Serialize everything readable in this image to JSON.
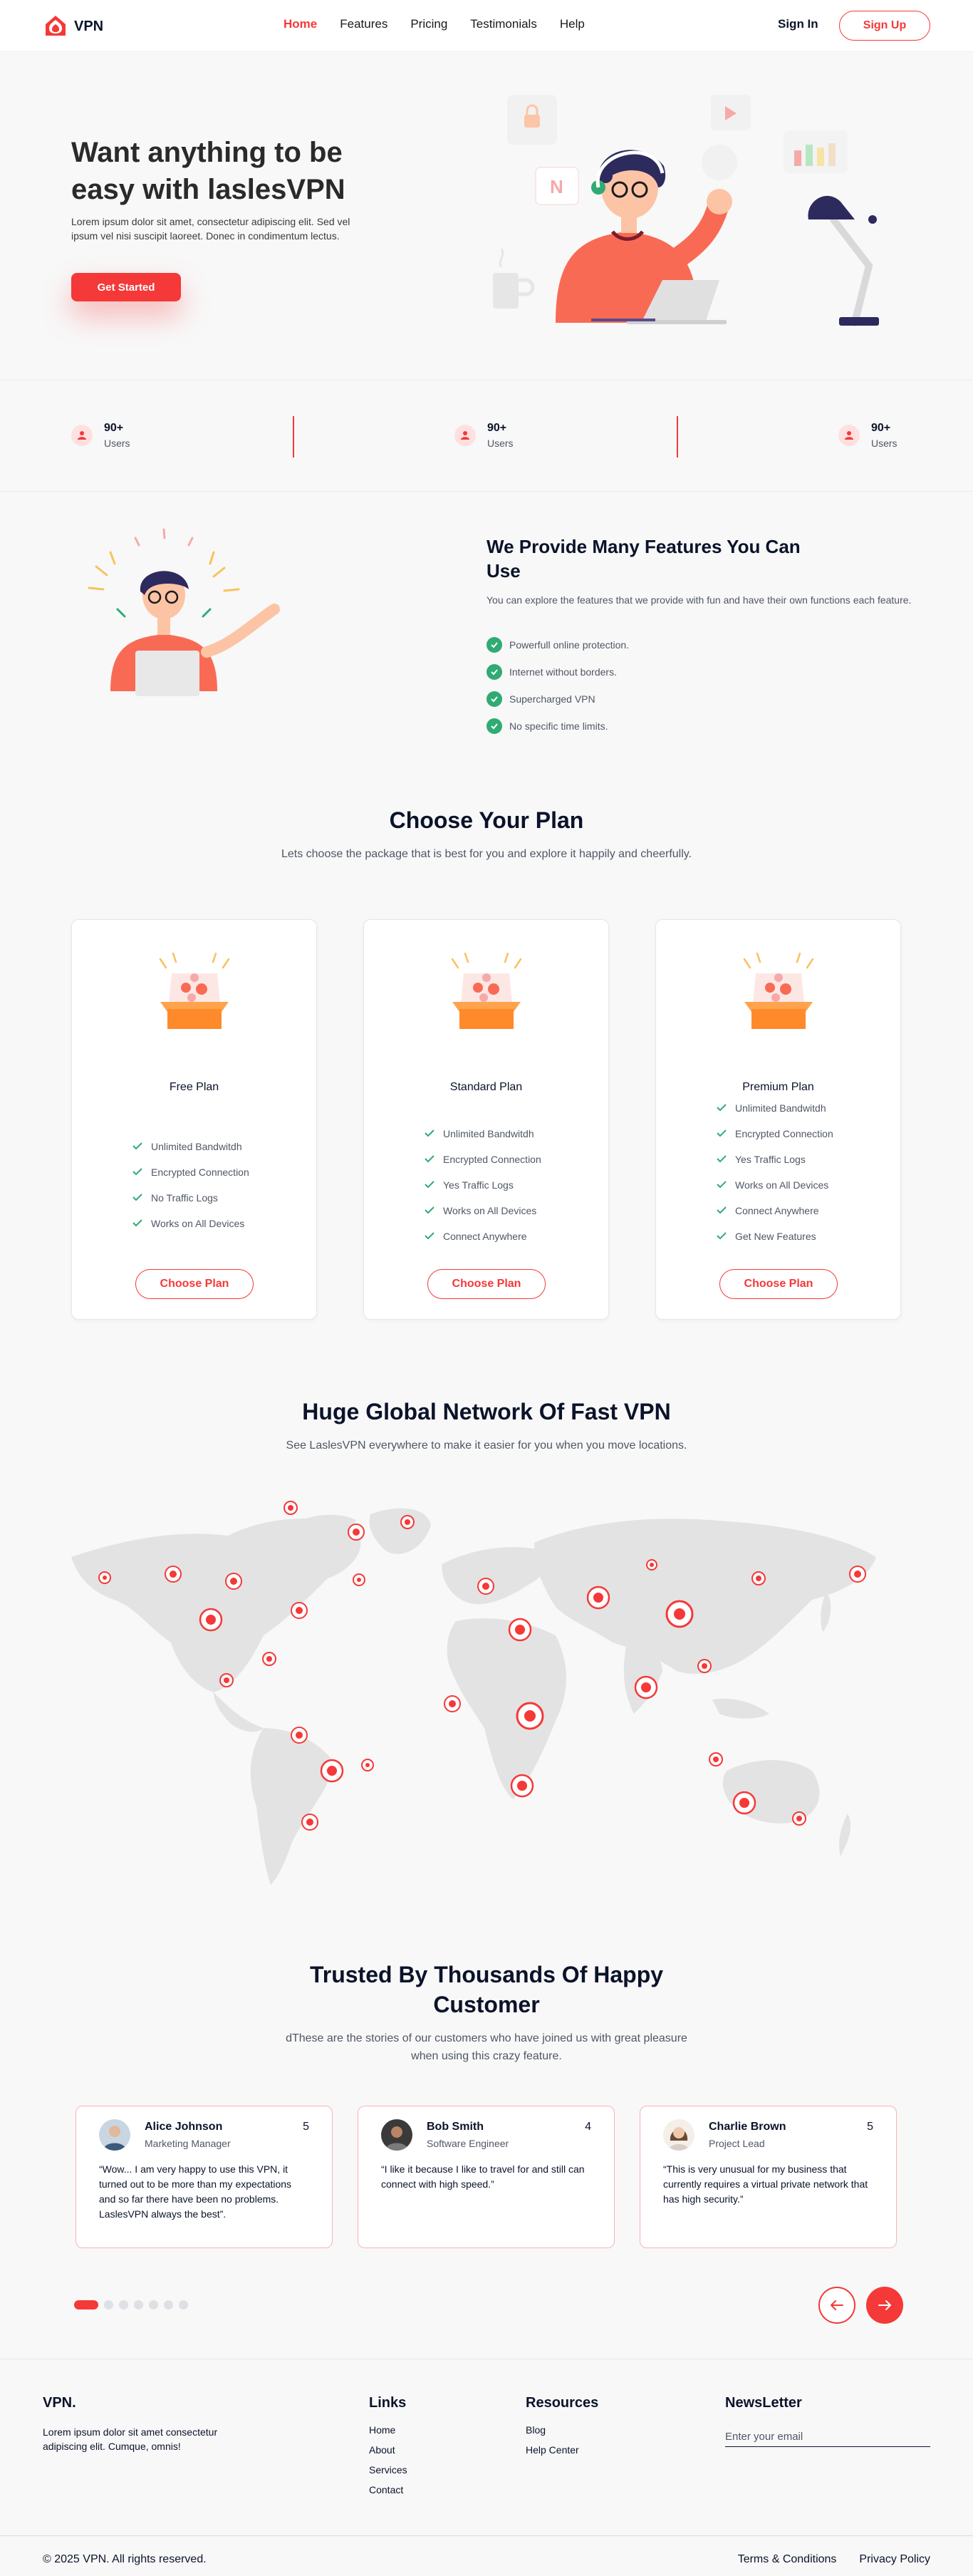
{
  "nav": {
    "logo_text": "VPN",
    "links": [
      "Home",
      "Features",
      "Pricing",
      "Testimonials",
      "Help"
    ],
    "sign_in": "Sign In",
    "sign_up": "Sign Up"
  },
  "hero": {
    "title": "Want anything to be easy with laslesVPN",
    "description": "Lorem ipsum dolor sit amet, consectetur adipiscing elit. Sed vel ipsum vel nisi suscipit laoreet. Donec in condimentum lectus.",
    "cta": "Get Started"
  },
  "stats": [
    {
      "value": "90+",
      "label": "Users"
    },
    {
      "value": "90+",
      "label": "Users"
    },
    {
      "value": "90+",
      "label": "Users"
    }
  ],
  "features": {
    "title": "We Provide Many Features You Can Use",
    "description": "You can explore the features that we provide with fun and have their own functions each feature.",
    "items": [
      "Powerfull online protection.",
      "Internet without borders.",
      "Supercharged VPN",
      "No specific time limits."
    ]
  },
  "plans_section": {
    "title": "Choose Your Plan",
    "subtitle": "Lets choose the package that is best for you and explore it happily and cheerfully."
  },
  "plans": [
    {
      "name": "Free Plan",
      "features": [
        "Unlimited Bandwitdh",
        "Encrypted Connection",
        "No Traffic Logs",
        "Works on All Devices"
      ],
      "button": "Choose Plan"
    },
    {
      "name": "Standard Plan",
      "features": [
        "Unlimited Bandwitdh",
        "Encrypted Connection",
        "Yes Traffic Logs",
        "Works on All Devices",
        "Connect Anywhere"
      ],
      "button": "Choose Plan"
    },
    {
      "name": "Premium Plan",
      "features": [
        "Unlimited Bandwitdh",
        "Encrypted Connection",
        "Yes Traffic Logs",
        "Works on All Devices",
        "Connect Anywhere",
        "Get New Features"
      ],
      "button": "Choose Plan"
    }
  ],
  "network": {
    "title": "Huge Global Network Of Fast VPN",
    "subtitle": "See LaslesVPN everywhere to make it easier for you when you move locations."
  },
  "testimonials_section": {
    "title": "Trusted By Thousands Of Happy Customer",
    "subtitle": "dThese are the stories of our customers who have joined us with great pleasure when using this crazy feature."
  },
  "testimonials": [
    {
      "name": "Alice Johnson",
      "role": "Marketing Manager",
      "rating": "5",
      "text": "“Wow... I am very happy to use this VPN, it turned out to be more than my expectations and so far there have been no problems. LaslesVPN always the best”."
    },
    {
      "name": "Bob Smith",
      "role": "Software Engineer",
      "rating": "4",
      "text": "“I like it because I like to travel for and still can connect with high speed.”"
    },
    {
      "name": "Charlie Brown",
      "role": "Project Lead",
      "rating": "5",
      "text": "“This is very unusual for my business that currently requires a virtual private network that has high security.”"
    }
  ],
  "footer": {
    "brand": "VPN.",
    "description": "Lorem ipsum dolor sit amet consectetur adipiscing elit. Cumque, omnis!",
    "links_title": "Links",
    "links": [
      "Home",
      "About",
      "Services",
      "Contact"
    ],
    "resources_title": "Resources",
    "resources": [
      "Blog",
      "Help Center"
    ],
    "newsletter_title": "NewsLetter",
    "newsletter_placeholder": "Enter your email",
    "copyright": "© 2025 VPN. All rights reserved.",
    "legal": [
      "Terms & Conditions",
      "Privacy Policy"
    ]
  },
  "colors": {
    "accent": "#f53838",
    "check": "#2fab73",
    "text_dark": "#0b132a"
  }
}
